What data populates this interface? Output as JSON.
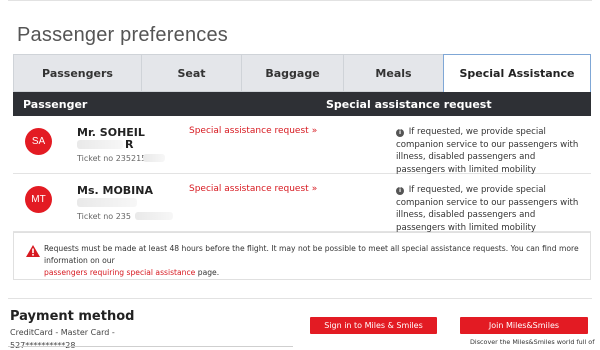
{
  "page": {
    "title": "Passenger preferences"
  },
  "tabs": [
    {
      "label": "Passengers"
    },
    {
      "label": "Seat"
    },
    {
      "label": "Baggage"
    },
    {
      "label": "Meals"
    },
    {
      "label": "Special Assistance",
      "active": true
    }
  ],
  "table": {
    "headers": {
      "passenger": "Passenger",
      "request": "Special assistance request"
    },
    "rows": [
      {
        "initials": "SA",
        "name": "Mr. SOHEIL",
        "name_extra": "R",
        "ticket": "Ticket no 235215",
        "request_link": "Special assistance request",
        "chevron": "»",
        "info": "If requested, we provide special companion service to our passengers with illness, disabled passengers and passengers with limited mobility"
      },
      {
        "initials": "MT",
        "name": "Ms. MOBINA",
        "ticket": "Ticket no 235",
        "request_link": "Special assistance request",
        "chevron": "»",
        "info": "If requested, we provide special companion service to our passengers with illness, disabled passengers and passengers with limited mobility"
      }
    ]
  },
  "notice": {
    "text": "Requests must be made at least 48 hours before the flight. It may not be possible to meet all special assistance requests. You can find more information on our",
    "link": "passengers requiring special assistance",
    "suffix": "page."
  },
  "payment": {
    "title": "Payment method",
    "line1": "CreditCard - Master Card -",
    "line2": "527**********28"
  },
  "buttons": {
    "signin": "Sign in to Miles & Smiles",
    "join": "Join Miles&Smiles",
    "join_sub": "Discover the Miles&Smiles world full of"
  },
  "colors": {
    "accent": "#e31b23",
    "header_bg": "#2e3035",
    "tab_bg": "#e4e6ea",
    "active_tab_border": "#7fa7d6"
  },
  "icons": {
    "info": "info-icon",
    "warning": "warning-icon",
    "avatar": "avatar"
  }
}
